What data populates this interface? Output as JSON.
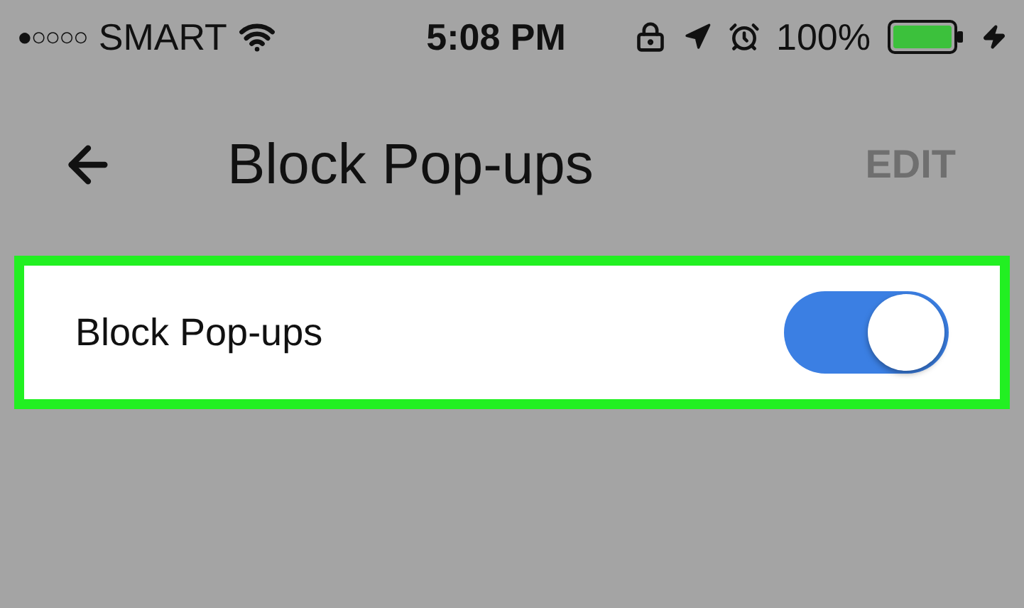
{
  "status_bar": {
    "signal": "●○○○○",
    "carrier": "SMART",
    "time": "5:08 PM",
    "battery": "100%"
  },
  "header": {
    "title": "Block Pop-ups",
    "action": "EDIT"
  },
  "settings": [
    {
      "label": "Block Pop-ups",
      "kind": "toggle",
      "on": true,
      "highlighted": true
    }
  ]
}
